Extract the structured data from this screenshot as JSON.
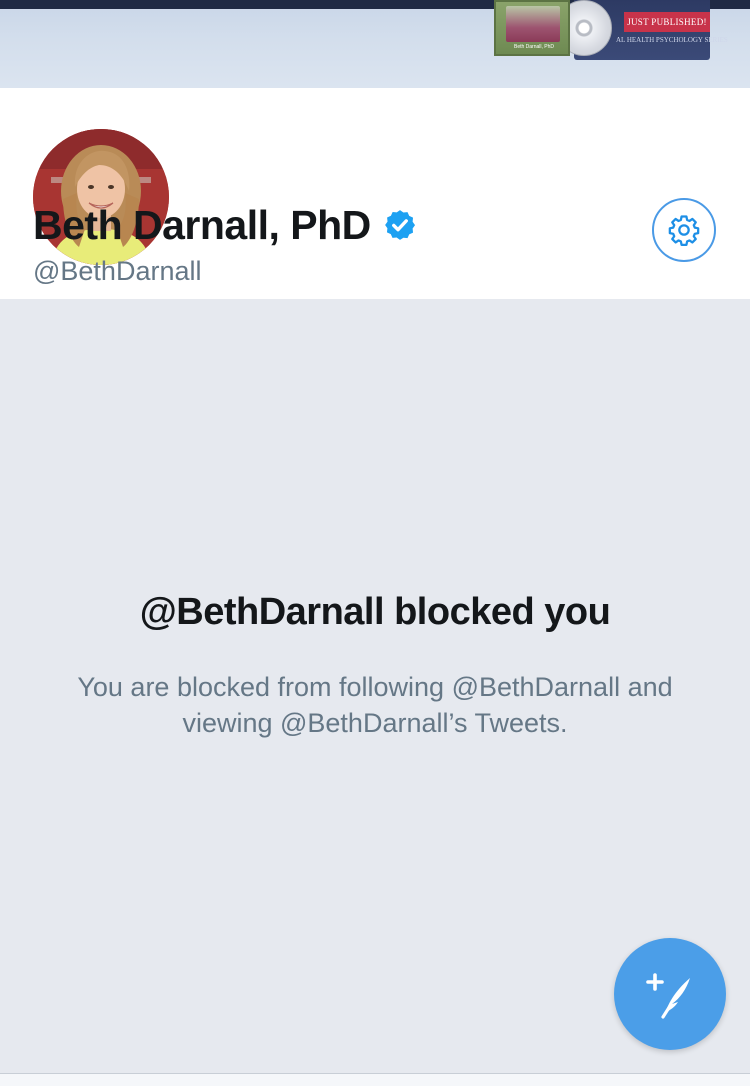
{
  "banner": {
    "ribbon_text": "JUST PUBLISHED!",
    "series_text": "AL HEALTH PSYCHOLOGY SERIES",
    "cover_title": "Beth Darnall, PhD"
  },
  "profile": {
    "display_name": "Beth Darnall, PhD",
    "handle": "@BethDarnall",
    "verified": true,
    "settings_icon": "gear-icon",
    "verified_icon": "verified-badge-icon",
    "accent_color": "#1da1f2"
  },
  "blocked": {
    "title": "@BethDarnall blocked you",
    "description": "You are blocked from following @BethDarnall and viewing @BethDarnall’s Tweets."
  },
  "compose": {
    "icon": "compose-tweet-icon",
    "color": "#4b9ee8"
  }
}
